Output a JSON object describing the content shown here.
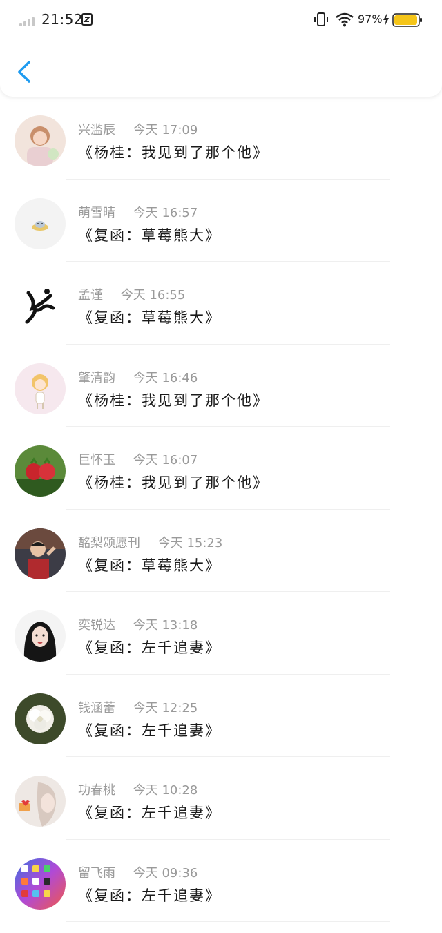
{
  "status_bar": {
    "time": "21:52",
    "battery_percent": "97%",
    "battery_level": 0.97,
    "colors": {
      "battery": "#f5c518",
      "accent": "#1e9bf0"
    }
  },
  "header": {
    "back_icon": "chevron-left-icon"
  },
  "messages": [
    {
      "name": "兴滥辰",
      "time": "今天 17:09",
      "text": "《杨桂：我见到了那个他》",
      "avatar": "girl-portrait-avatar"
    },
    {
      "name": "萌雪晴",
      "time": "今天 16:57",
      "text": "《复函：草莓熊大》",
      "avatar": "cat-on-plate-avatar"
    },
    {
      "name": "孟谨",
      "time": "今天 16:55",
      "text": "《复函：草莓熊大》",
      "avatar": "dancer-sketch-avatar"
    },
    {
      "name": "肇清韵",
      "time": "今天 16:46",
      "text": "《杨桂：我见到了那个他》",
      "avatar": "cartoon-girl-avatar"
    },
    {
      "name": "巨怀玉",
      "time": "今天 16:07",
      "text": "《杨桂：我见到了那个他》",
      "avatar": "strawberries-avatar"
    },
    {
      "name": "酩梨颂愿刊",
      "time": "今天 15:23",
      "text": "《复函：草莓熊大》",
      "avatar": "boy-photo-avatar"
    },
    {
      "name": "奕锐达",
      "time": "今天 13:18",
      "text": "《复函：左千追妻》",
      "avatar": "anime-girl-avatar"
    },
    {
      "name": "钱涵蕾",
      "time": "今天 12:25",
      "text": "《复函：左千追妻》",
      "avatar": "white-flower-avatar"
    },
    {
      "name": "功春桃",
      "time": "今天 10:28",
      "text": "《复函：左千追妻》",
      "avatar": "woman-portrait-avatar"
    },
    {
      "name": "留飞雨",
      "time": "今天 09:36",
      "text": "《复函：左千追妻》",
      "avatar": "phone-screen-avatar"
    }
  ]
}
